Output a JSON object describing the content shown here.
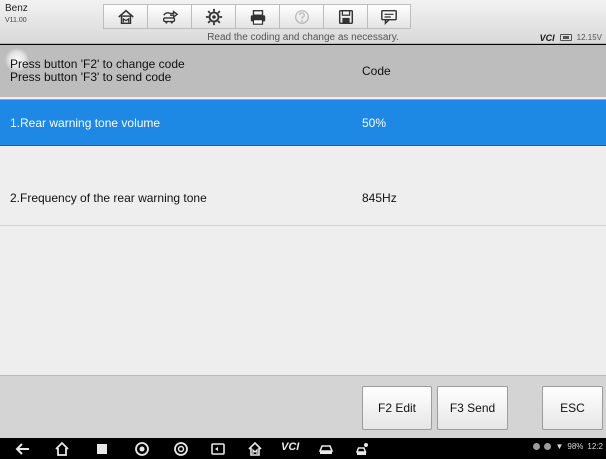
{
  "header": {
    "app_name": "Benz",
    "version": "V11.00",
    "toolbar_icons": [
      "home-icon",
      "vehicle-swap-icon",
      "settings-icon",
      "print-icon",
      "help-icon",
      "save-icon",
      "chat-icon"
    ],
    "status_message": "Read the coding and change as necessary.",
    "vci_label": "VCI",
    "voltage": "12.15V"
  },
  "table": {
    "header": {
      "line1": "Press button 'F2' to change code",
      "line2": "Press button 'F3' to send code",
      "value_col": "Code"
    },
    "rows": [
      {
        "label": "1.Rear warning tone volume",
        "value": "50%",
        "selected": true
      },
      {
        "label": "2.Frequency of the rear warning tone",
        "value": "845Hz",
        "selected": false
      }
    ]
  },
  "function_keys": {
    "f2": "F2 Edit",
    "f3": "F3 Send",
    "esc": "ESC"
  },
  "navbar": {
    "vci_label": "VCI",
    "battery": "98%",
    "time": "12:2"
  },
  "colors": {
    "selection": "#1e88e5",
    "header_bg": "#bdbdbd",
    "content_bg": "#eeeeee"
  }
}
